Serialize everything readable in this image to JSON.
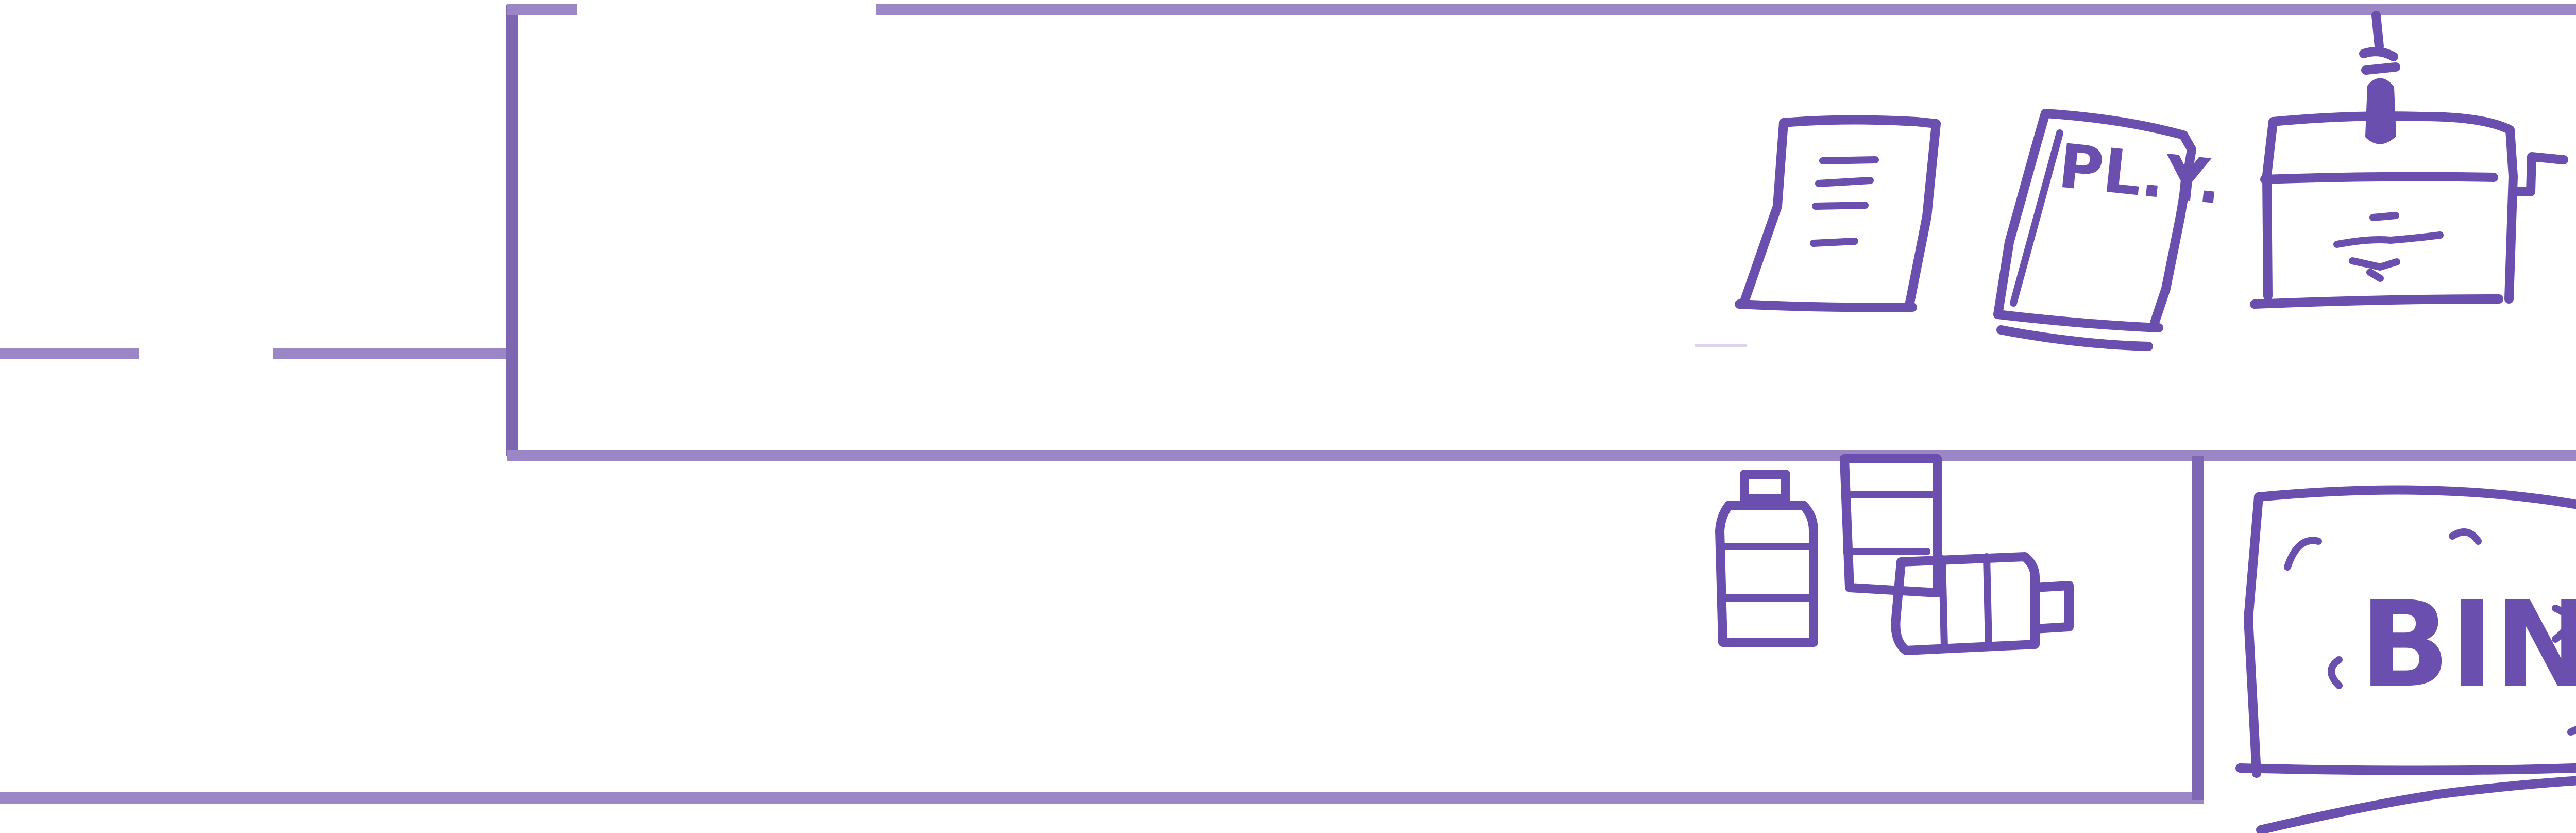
{
  "diagram": {
    "colors": {
      "ink": "#6a4fae",
      "wall": "#9b86c6",
      "background": "#ffffff"
    },
    "items": [
      {
        "name": "document-icon"
      },
      {
        "name": "notebook-icon",
        "label": "PL.Y."
      },
      {
        "name": "press-machine-icon"
      },
      {
        "name": "bottles-cluster-icon"
      },
      {
        "name": "bin-icon",
        "label": "BIN"
      }
    ]
  }
}
